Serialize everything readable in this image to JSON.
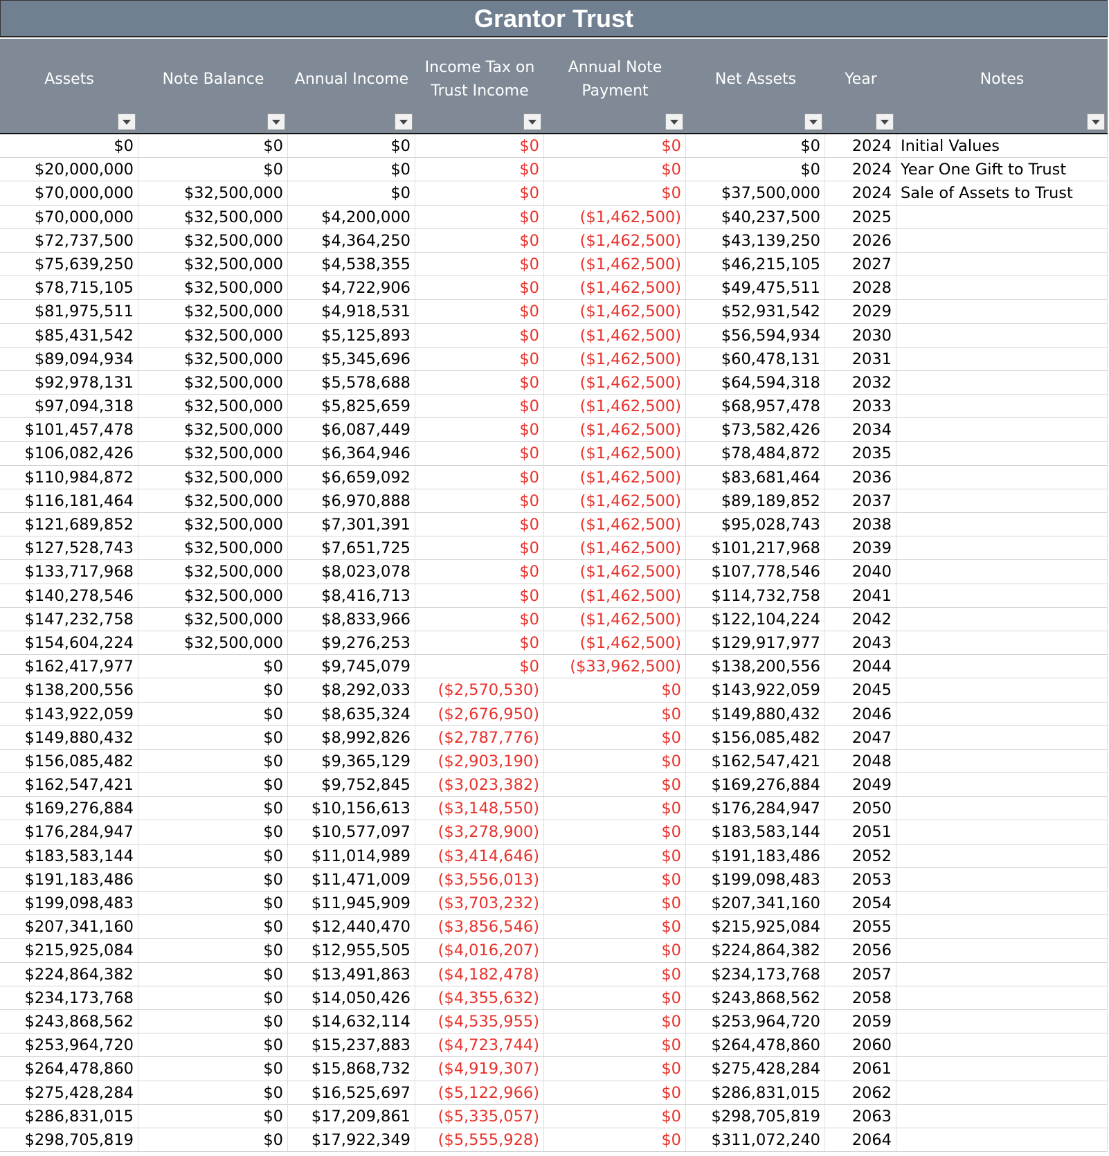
{
  "title": "Grantor Trust",
  "headers": [
    {
      "key": "assets",
      "label": "Assets"
    },
    {
      "key": "note_balance",
      "label": "Note Balance"
    },
    {
      "key": "annual_income",
      "label": "Annual Income"
    },
    {
      "key": "income_tax",
      "label": "Income Tax on\nTrust Income"
    },
    {
      "key": "note_payment",
      "label": "Annual Note\nPayment"
    },
    {
      "key": "net_assets",
      "label": "Net Assets"
    },
    {
      "key": "year",
      "label": "Year"
    },
    {
      "key": "notes",
      "label": "Notes"
    }
  ],
  "rows": [
    [
      "$0",
      "$0",
      "$0",
      "$0",
      "$0",
      "$0",
      "2024",
      "Initial Values"
    ],
    [
      "$20,000,000",
      "$0",
      "$0",
      "$0",
      "$0",
      "$0",
      "2024",
      "Year One Gift to Trust"
    ],
    [
      "$70,000,000",
      "$32,500,000",
      "$0",
      "$0",
      "$0",
      "$37,500,000",
      "2024",
      "Sale of Assets to Trust"
    ],
    [
      "$70,000,000",
      "$32,500,000",
      "$4,200,000",
      "$0",
      "($1,462,500)",
      "$40,237,500",
      "2025",
      ""
    ],
    [
      "$72,737,500",
      "$32,500,000",
      "$4,364,250",
      "$0",
      "($1,462,500)",
      "$43,139,250",
      "2026",
      ""
    ],
    [
      "$75,639,250",
      "$32,500,000",
      "$4,538,355",
      "$0",
      "($1,462,500)",
      "$46,215,105",
      "2027",
      ""
    ],
    [
      "$78,715,105",
      "$32,500,000",
      "$4,722,906",
      "$0",
      "($1,462,500)",
      "$49,475,511",
      "2028",
      ""
    ],
    [
      "$81,975,511",
      "$32,500,000",
      "$4,918,531",
      "$0",
      "($1,462,500)",
      "$52,931,542",
      "2029",
      ""
    ],
    [
      "$85,431,542",
      "$32,500,000",
      "$5,125,893",
      "$0",
      "($1,462,500)",
      "$56,594,934",
      "2030",
      ""
    ],
    [
      "$89,094,934",
      "$32,500,000",
      "$5,345,696",
      "$0",
      "($1,462,500)",
      "$60,478,131",
      "2031",
      ""
    ],
    [
      "$92,978,131",
      "$32,500,000",
      "$5,578,688",
      "$0",
      "($1,462,500)",
      "$64,594,318",
      "2032",
      ""
    ],
    [
      "$97,094,318",
      "$32,500,000",
      "$5,825,659",
      "$0",
      "($1,462,500)",
      "$68,957,478",
      "2033",
      ""
    ],
    [
      "$101,457,478",
      "$32,500,000",
      "$6,087,449",
      "$0",
      "($1,462,500)",
      "$73,582,426",
      "2034",
      ""
    ],
    [
      "$106,082,426",
      "$32,500,000",
      "$6,364,946",
      "$0",
      "($1,462,500)",
      "$78,484,872",
      "2035",
      ""
    ],
    [
      "$110,984,872",
      "$32,500,000",
      "$6,659,092",
      "$0",
      "($1,462,500)",
      "$83,681,464",
      "2036",
      ""
    ],
    [
      "$116,181,464",
      "$32,500,000",
      "$6,970,888",
      "$0",
      "($1,462,500)",
      "$89,189,852",
      "2037",
      ""
    ],
    [
      "$121,689,852",
      "$32,500,000",
      "$7,301,391",
      "$0",
      "($1,462,500)",
      "$95,028,743",
      "2038",
      ""
    ],
    [
      "$127,528,743",
      "$32,500,000",
      "$7,651,725",
      "$0",
      "($1,462,500)",
      "$101,217,968",
      "2039",
      ""
    ],
    [
      "$133,717,968",
      "$32,500,000",
      "$8,023,078",
      "$0",
      "($1,462,500)",
      "$107,778,546",
      "2040",
      ""
    ],
    [
      "$140,278,546",
      "$32,500,000",
      "$8,416,713",
      "$0",
      "($1,462,500)",
      "$114,732,758",
      "2041",
      ""
    ],
    [
      "$147,232,758",
      "$32,500,000",
      "$8,833,966",
      "$0",
      "($1,462,500)",
      "$122,104,224",
      "2042",
      ""
    ],
    [
      "$154,604,224",
      "$32,500,000",
      "$9,276,253",
      "$0",
      "($1,462,500)",
      "$129,917,977",
      "2043",
      ""
    ],
    [
      "$162,417,977",
      "$0",
      "$9,745,079",
      "$0",
      "($33,962,500)",
      "$138,200,556",
      "2044",
      ""
    ],
    [
      "$138,200,556",
      "$0",
      "$8,292,033",
      "($2,570,530)",
      "$0",
      "$143,922,059",
      "2045",
      ""
    ],
    [
      "$143,922,059",
      "$0",
      "$8,635,324",
      "($2,676,950)",
      "$0",
      "$149,880,432",
      "2046",
      ""
    ],
    [
      "$149,880,432",
      "$0",
      "$8,992,826",
      "($2,787,776)",
      "$0",
      "$156,085,482",
      "2047",
      ""
    ],
    [
      "$156,085,482",
      "$0",
      "$9,365,129",
      "($2,903,190)",
      "$0",
      "$162,547,421",
      "2048",
      ""
    ],
    [
      "$162,547,421",
      "$0",
      "$9,752,845",
      "($3,023,382)",
      "$0",
      "$169,276,884",
      "2049",
      ""
    ],
    [
      "$169,276,884",
      "$0",
      "$10,156,613",
      "($3,148,550)",
      "$0",
      "$176,284,947",
      "2050",
      ""
    ],
    [
      "$176,284,947",
      "$0",
      "$10,577,097",
      "($3,278,900)",
      "$0",
      "$183,583,144",
      "2051",
      ""
    ],
    [
      "$183,583,144",
      "$0",
      "$11,014,989",
      "($3,414,646)",
      "$0",
      "$191,183,486",
      "2052",
      ""
    ],
    [
      "$191,183,486",
      "$0",
      "$11,471,009",
      "($3,556,013)",
      "$0",
      "$199,098,483",
      "2053",
      ""
    ],
    [
      "$199,098,483",
      "$0",
      "$11,945,909",
      "($3,703,232)",
      "$0",
      "$207,341,160",
      "2054",
      ""
    ],
    [
      "$207,341,160",
      "$0",
      "$12,440,470",
      "($3,856,546)",
      "$0",
      "$215,925,084",
      "2055",
      ""
    ],
    [
      "$215,925,084",
      "$0",
      "$12,955,505",
      "($4,016,207)",
      "$0",
      "$224,864,382",
      "2056",
      ""
    ],
    [
      "$224,864,382",
      "$0",
      "$13,491,863",
      "($4,182,478)",
      "$0",
      "$234,173,768",
      "2057",
      ""
    ],
    [
      "$234,173,768",
      "$0",
      "$14,050,426",
      "($4,355,632)",
      "$0",
      "$243,868,562",
      "2058",
      ""
    ],
    [
      "$243,868,562",
      "$0",
      "$14,632,114",
      "($4,535,955)",
      "$0",
      "$253,964,720",
      "2059",
      ""
    ],
    [
      "$253,964,720",
      "$0",
      "$15,237,883",
      "($4,723,744)",
      "$0",
      "$264,478,860",
      "2060",
      ""
    ],
    [
      "$264,478,860",
      "$0",
      "$15,868,732",
      "($4,919,307)",
      "$0",
      "$275,428,284",
      "2061",
      ""
    ],
    [
      "$275,428,284",
      "$0",
      "$16,525,697",
      "($5,122,966)",
      "$0",
      "$286,831,015",
      "2062",
      ""
    ],
    [
      "$286,831,015",
      "$0",
      "$17,209,861",
      "($5,335,057)",
      "$0",
      "$298,705,819",
      "2063",
      ""
    ],
    [
      "$298,705,819",
      "$0",
      "$17,922,349",
      "($5,555,928)",
      "$0",
      "$311,072,240",
      "2064",
      ""
    ]
  ],
  "colors": {
    "title_bg": "#708090",
    "header_bg": "#7f8a96",
    "negative_text": "#e8322b",
    "indicator_green": "#1a8f1a"
  },
  "icons": {
    "filter": "filter-dropdown-icon",
    "error_indicator": "green-triangle-indicator-icon"
  }
}
